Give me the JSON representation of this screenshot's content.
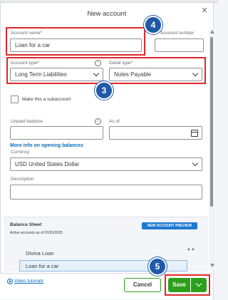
{
  "dialog": {
    "title": "New account",
    "close_glyph": "×"
  },
  "account_name": {
    "label": "Account name*",
    "value": "Loan for a car"
  },
  "account_number": {
    "label": "Account number",
    "value": ""
  },
  "account_type": {
    "label": "Account type*",
    "value": "Long Term Liabilities"
  },
  "detail_type": {
    "label": "Detail type*",
    "value": "Notes Payable"
  },
  "subaccount": {
    "label": "Make this a subaccount",
    "checked": false
  },
  "unpaid_balance": {
    "label": "Unpaid balance",
    "value": ""
  },
  "as_of": {
    "label": "As of",
    "value": ""
  },
  "opening_balance_link": "More info on opening balances",
  "currency": {
    "label": "Currency",
    "value": "USD United States Dollar"
  },
  "description": {
    "label": "Description",
    "value": ""
  },
  "balance_sheet": {
    "title": "Balance Sheet",
    "subtitle": "Active accounts as of 03/20/2025",
    "preview_label": "NEW ACCOUNT PREVIEW",
    "items": [
      {
        "label": "Divina Loan"
      },
      {
        "label": "Loan for a car"
      }
    ]
  },
  "footer": {
    "video_label": "Video tutorials",
    "cancel_label": "Cancel",
    "save_label": "Save"
  },
  "annotations": {
    "step_account_name": "4",
    "step_account_type": "3",
    "step_save": "5"
  },
  "colors": {
    "accent_green": "#2ca01c",
    "highlight_red": "#e0282c",
    "badge_blue": "#1e5aa8",
    "link_blue": "#0d6dba"
  }
}
